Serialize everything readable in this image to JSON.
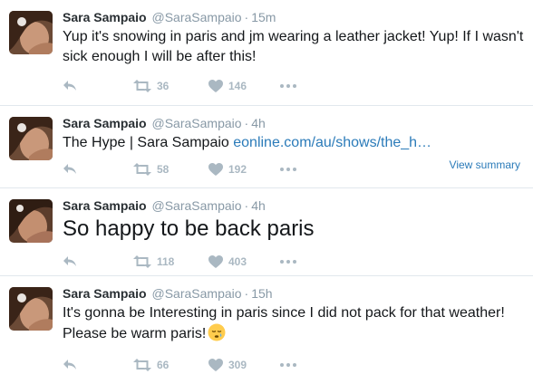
{
  "colors": {
    "action_gray": "#aab8c2",
    "link_blue": "#2b7bb9",
    "divider": "#e1e8ed",
    "meta_gray": "#8899a6"
  },
  "tweets": [
    {
      "name": "Sara Sampaio",
      "handle": "@SaraSampaio",
      "sep": "·",
      "time": "15m",
      "text": "Yup it's snowing in paris and jm wearing a leather jacket! Yup! If I wasn't sick enough I will be after this!",
      "retweets": "36",
      "likes": "146",
      "icons": [
        "reply-icon",
        "retweet-icon",
        "heart-icon",
        "more-icon"
      ]
    },
    {
      "name": "Sara Sampaio",
      "handle": "@SaraSampaio",
      "sep": "·",
      "time": "4h",
      "text_prefix": "The Hype | Sara Sampaio ",
      "link": "eonline.com/au/shows/the_h…",
      "retweets": "58",
      "likes": "192",
      "view_summary": "View summary"
    },
    {
      "name": "Sara Sampaio",
      "handle": "@SaraSampaio",
      "sep": "·",
      "time": "4h",
      "text": "So happy to be back paris",
      "retweets": "118",
      "likes": "403"
    },
    {
      "name": "Sara Sampaio",
      "handle": "@SaraSampaio",
      "sep": "·",
      "time": "15h",
      "text": "It's gonna be Interesting in paris since I did not pack for that weather! Please be warm paris!",
      "emoji": "sleepy-face-emoji",
      "retweets": "66",
      "likes": "309"
    }
  ]
}
